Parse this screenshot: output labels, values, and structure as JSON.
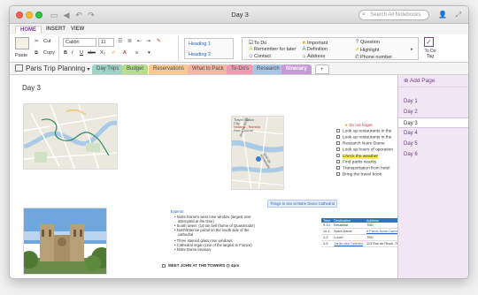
{
  "window": {
    "title": "Day 3"
  },
  "search": {
    "placeholder": "Search All Notebooks"
  },
  "ribbon_tabs": [
    {
      "label": "HOME",
      "active": true
    },
    {
      "label": "INSERT",
      "active": false
    },
    {
      "label": "VIEW",
      "active": false
    }
  ],
  "ribbon": {
    "paste": "Paste",
    "cut": "Cut",
    "copy": "Copy",
    "font_name": "Calibri",
    "font_size": "11",
    "styles": [
      "Heading 1",
      "Heading 2"
    ],
    "tags": [
      {
        "icon": "checkbox-icon",
        "label": "To Do"
      },
      {
        "icon": "star-icon",
        "label": "Important"
      },
      {
        "icon": "question-icon",
        "label": "Question"
      },
      {
        "icon": "remember-icon",
        "label": "Remember for later"
      },
      {
        "icon": "definition-icon",
        "label": "Definition"
      },
      {
        "icon": "highlight-icon",
        "label": "Highlight"
      },
      {
        "icon": "contact-icon",
        "label": "Contact"
      },
      {
        "icon": "address-icon",
        "label": "Address"
      },
      {
        "icon": "phone-icon",
        "label": "Phone number"
      }
    ],
    "todo_tag": "To Do Tag"
  },
  "notebook": {
    "title": "Paris Trip Planning",
    "sections": [
      {
        "label": "Day Trips",
        "color": "#9fd3c7"
      },
      {
        "label": "Budget",
        "color": "#b7dd8c"
      },
      {
        "label": "Reservations",
        "color": "#f6c98f"
      },
      {
        "label": "What to Pack",
        "color": "#f4b6a2"
      },
      {
        "label": "To-Do's",
        "color": "#f29bb0"
      },
      {
        "label": "Research",
        "color": "#a8c6ea"
      },
      {
        "label": "Itinerary",
        "color": "#c69bd8",
        "active": true
      }
    ],
    "add_section": "+"
  },
  "pages": {
    "add_page": "Add Page",
    "items": [
      {
        "label": "Day 1",
        "active": false
      },
      {
        "label": "Day 2",
        "active": false
      },
      {
        "label": "Day 3",
        "active": true
      },
      {
        "label": "Day 4",
        "active": false
      },
      {
        "label": "Day 5",
        "active": false
      },
      {
        "label": "Day 6",
        "active": false
      }
    ]
  },
  "canvas": {
    "page_title": "Day 3",
    "map2_caption": [
      "Travel Station",
      "City",
      "Nearest - Rambla",
      "Rive Gauche"
    ],
    "map2_labels": [
      "Rue de Rivoli",
      "Quai de Montebello"
    ],
    "todo_header": "Do not forget:",
    "todos": [
      {
        "text": "Look up restaurants in the",
        "checked": false,
        "highlight": false
      },
      {
        "text": "Look up restaurants in the",
        "checked": false,
        "highlight": false
      },
      {
        "text": "Research Notre Dame",
        "checked": false,
        "highlight": false
      },
      {
        "text": "Look up hours of operation",
        "checked": false,
        "highlight": false
      },
      {
        "text": "Check the weather",
        "checked": false,
        "highlight": true
      },
      {
        "text": "Find parks nearby",
        "checked": false,
        "highlight": false
      },
      {
        "text": "Transportation from hotel",
        "checked": false,
        "highlight": false
      },
      {
        "text": "Bring the travel book",
        "checked": false,
        "highlight": false
      }
    ],
    "link_text": "Things to see at Notre Dame Cathedral",
    "exterior_label": "Exterior:",
    "exterior_bullets": [
      "Notre Dame's west rose window (largest ever",
      "attempted at the time)",
      "South tower: (14 ton bell (home of Quasimodo!)",
      "North/Etienne portal on the south side of the",
      "cathedral"
    ],
    "interior_bullets": [
      "Three stained glass rose windows",
      "Cathedral organ (one of the largest in France)",
      "Notre Dame treasury"
    ],
    "meet_text": "MEET JOHN AT THE TOWERS @ 4pm",
    "schedule": {
      "headers": [
        "Time",
        "Destination",
        "Address"
      ],
      "rows": [
        [
          "9-10",
          "Breakfast",
          "TBD"
        ],
        [
          "10-1",
          "Notre Dame",
          "6 Parvis Notre-Dame"
        ],
        [
          "1-3",
          "Lunch",
          "TBD"
        ],
        [
          "3-5",
          "Jardin des Tuileries",
          "113 Rue de Rivoli, 75"
        ]
      ]
    }
  }
}
